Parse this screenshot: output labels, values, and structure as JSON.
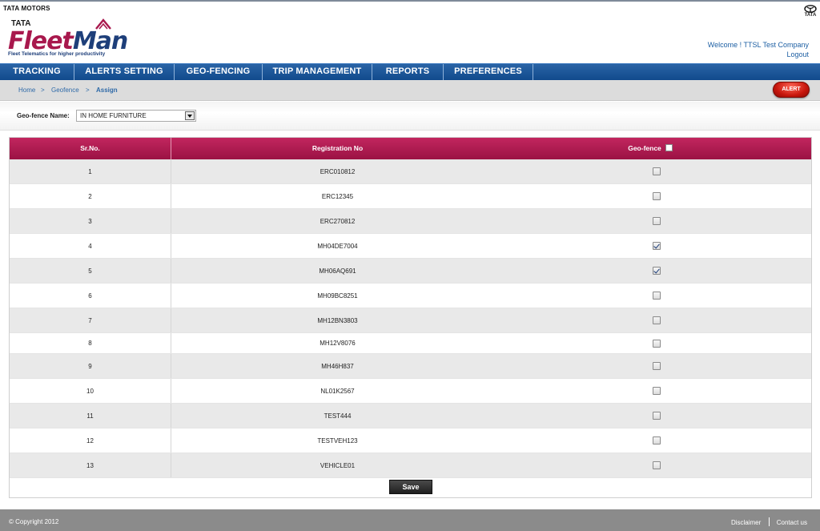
{
  "header": {
    "brand_top": "TATA MOTORS",
    "logo_tata": "TATA",
    "logo_fleet": "Fleet",
    "logo_man": "Man",
    "logo_tagline": "Fleet Telematics for higher productivity",
    "emblem_label": "TATA",
    "welcome": "Welcome ! TTSL Test Company",
    "logout": "Logout"
  },
  "nav": [
    {
      "label": "TRACKING"
    },
    {
      "label": "ALERTS SETTING"
    },
    {
      "label": "GEO-FENCING"
    },
    {
      "label": "TRIP MANAGEMENT"
    },
    {
      "label": "REPORTS"
    },
    {
      "label": "PREFERENCES"
    }
  ],
  "breadcrumb": {
    "home": "Home",
    "sep": ">",
    "geofence": "Geofence",
    "assign": "Assign"
  },
  "alert_button": "ALERT",
  "filter": {
    "label": "Geo-fence Name:",
    "selected": "IN HOME FURNITURE"
  },
  "table": {
    "headers": {
      "srno": "Sr.No.",
      "reg": "Registration No",
      "geofence": "Geo-fence"
    },
    "rows": [
      {
        "srno": "1",
        "reg": "ERC010812",
        "checked": false
      },
      {
        "srno": "2",
        "reg": "ERC12345",
        "checked": false
      },
      {
        "srno": "3",
        "reg": "ERC270812",
        "checked": false
      },
      {
        "srno": "4",
        "reg": "MH04DE7004",
        "checked": true
      },
      {
        "srno": "5",
        "reg": "MH06AQ691",
        "checked": true
      },
      {
        "srno": "6",
        "reg": "MH09BC8251",
        "checked": false
      },
      {
        "srno": "7",
        "reg": "MH12BN3803",
        "checked": false
      },
      {
        "srno": "8",
        "reg": "MH12V8076",
        "checked": false
      },
      {
        "srno": "9",
        "reg": "MH46H837",
        "checked": false
      },
      {
        "srno": "10",
        "reg": "NL01K2567",
        "checked": false
      },
      {
        "srno": "11",
        "reg": "TEST444",
        "checked": false
      },
      {
        "srno": "12",
        "reg": "TESTVEH123",
        "checked": false
      },
      {
        "srno": "13",
        "reg": "VEHICLE01",
        "checked": false
      }
    ],
    "save_label": "Save"
  },
  "footer": {
    "copyright": "© Copyright 2012",
    "disclaimer": "Disclaimer",
    "contact": "Contact us"
  }
}
